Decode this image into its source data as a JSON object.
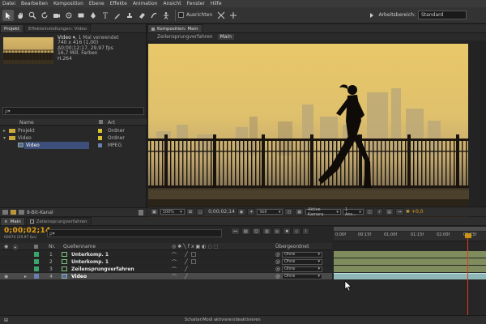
{
  "menu": [
    "Datei",
    "Bearbeiten",
    "Komposition",
    "Ebene",
    "Effekte",
    "Animation",
    "Ansicht",
    "Fenster",
    "Hilfe"
  ],
  "toolbar": {
    "align_label": "Ausrichten",
    "workspace_label": "Arbeitsbereich:",
    "workspace_value": "Standard"
  },
  "project": {
    "tab_project": "Projekt",
    "tab_effects": "Effekteinstellungen: Video",
    "info_name": "Video ▾",
    "info_used": ", 1 Mal verwendet",
    "info_lines": [
      "740 x 416 (1,00)",
      "Δ0;00;12;17, 29,97 fps",
      "16,7 Mill. Farben",
      "H.264"
    ],
    "search_placeholder": "ρ▾",
    "col_name": "Name",
    "col_type": "Art",
    "items": [
      {
        "name": "Projekt",
        "type": "Ordner",
        "color": "#d6c32d"
      },
      {
        "name": "Video",
        "type": "Ordner",
        "color": "#d6c32d"
      },
      {
        "name": "Video",
        "type": "MPEG",
        "color": "#6a7fb0"
      }
    ],
    "bitdepth": "8-Bit-Kanal"
  },
  "composition": {
    "tab_label": "Komposition: Main",
    "crumb1": "Zeilensprungverfahren",
    "crumb2": "Main",
    "zoom": "100%",
    "timecode": "0;00;02;14",
    "channel": "Voll",
    "camera": "Aktive Kamera",
    "view": "1 Ans...",
    "exposure": "+0,0"
  },
  "timeline": {
    "tab_main": "Main",
    "tab_interlace": "Zeilensprungverfahren",
    "timecode": "0;00;02;14",
    "fps": "00074 (29.97 fps)",
    "search_placeholder": "ρ▾",
    "col_nr": "Nr.",
    "col_source": "Quellenname",
    "col_parent": "Übergeordnet",
    "ruler": [
      "0:00f",
      "00:15f",
      "01:00f",
      "01:15f",
      "02:00f",
      "02:15f"
    ],
    "layers": [
      {
        "nr": "1",
        "name": "Unterkomp. 1",
        "parent": "Ohne",
        "color": "#3aa56a"
      },
      {
        "nr": "2",
        "name": "Unterkomp. 1",
        "parent": "Ohne",
        "color": "#3aa56a"
      },
      {
        "nr": "3",
        "name": "Zeilensprungverfahren",
        "parent": "Ohne",
        "color": "#3aa56a"
      },
      {
        "nr": "4",
        "name": "Video",
        "parent": "Ohne",
        "color": "#6a7fb0"
      }
    ],
    "footer": "Schalter/Modi aktivieren/deaktivieren"
  },
  "colors": {
    "accent": "#e7a20e",
    "sky_top": "#e8c567",
    "sky_bottom": "#bfa56a",
    "playhead": "#e03a1e"
  }
}
